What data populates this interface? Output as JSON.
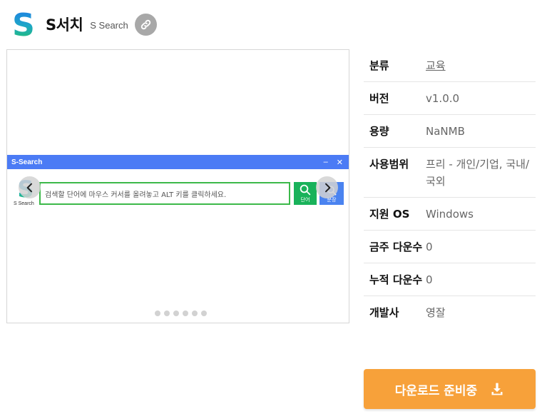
{
  "header": {
    "title": "S서치",
    "subtitle": "S Search"
  },
  "preview": {
    "window_title": "S-Search",
    "window_min": "–",
    "window_close": "✕",
    "logo_label": "S Search",
    "input_placeholder": "검색할 단어에 마우스 커서를 올려놓고 ALT 키를 클릭하세요.",
    "search_btn_label": "단어",
    "phrase_btn_label": "문장",
    "dot_count": 6
  },
  "info": {
    "rows": [
      {
        "label": "분류",
        "value": "교육"
      },
      {
        "label": "버전",
        "value": "v1.0.0"
      },
      {
        "label": "용량",
        "value": "NaNMB"
      },
      {
        "label": "사용범위",
        "value": "프리 - 개인/기업, 국내/국외"
      },
      {
        "label": "지원 OS",
        "value": "Windows"
      },
      {
        "label": "금주 다운수",
        "value": "0"
      },
      {
        "label": "누적 다운수",
        "value": "0"
      },
      {
        "label": "개발사",
        "value": "영잘"
      }
    ]
  },
  "download": {
    "label": "다운로드 준비중"
  },
  "colors": {
    "accent": "#f7a13a",
    "titlebar": "#4b7bf5",
    "logo_blue": "#1e7be8",
    "logo_green": "#22c55e"
  }
}
